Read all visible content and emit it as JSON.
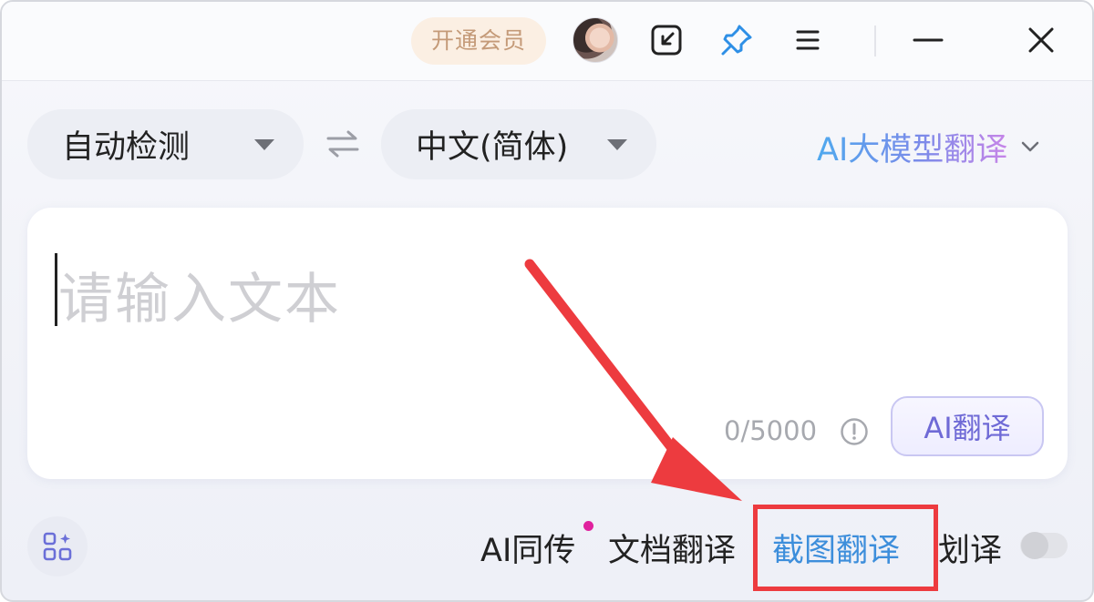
{
  "titlebar": {
    "vip_label": "开通会员",
    "icons": [
      "avatar",
      "mini-window-icon",
      "pin-icon",
      "menu-icon",
      "minimize-icon",
      "close-icon"
    ]
  },
  "languages": {
    "source": "自动检测",
    "target": "中文(简体)",
    "swap_icon": "swap-arrows-icon",
    "mode_label": "AI大模型翻译"
  },
  "input": {
    "placeholder": "请输入文本",
    "counter": "0/5000",
    "translate_button": "AI翻译"
  },
  "toolbar": {
    "items": [
      {
        "label": "AI同传",
        "new_dot": true
      },
      {
        "label": "文档翻译"
      },
      {
        "label": "截图翻译",
        "active": true
      },
      {
        "label": "划译"
      }
    ],
    "toggle_on": false
  },
  "colors": {
    "active_link": "#3d8edb",
    "annotation_red": "#ed3b3f",
    "ai_gradient_start": "#4fa9ee",
    "ai_gradient_end": "#c785e8",
    "vip_text": "#c49a78",
    "ai_button": "#6f6ad6"
  }
}
